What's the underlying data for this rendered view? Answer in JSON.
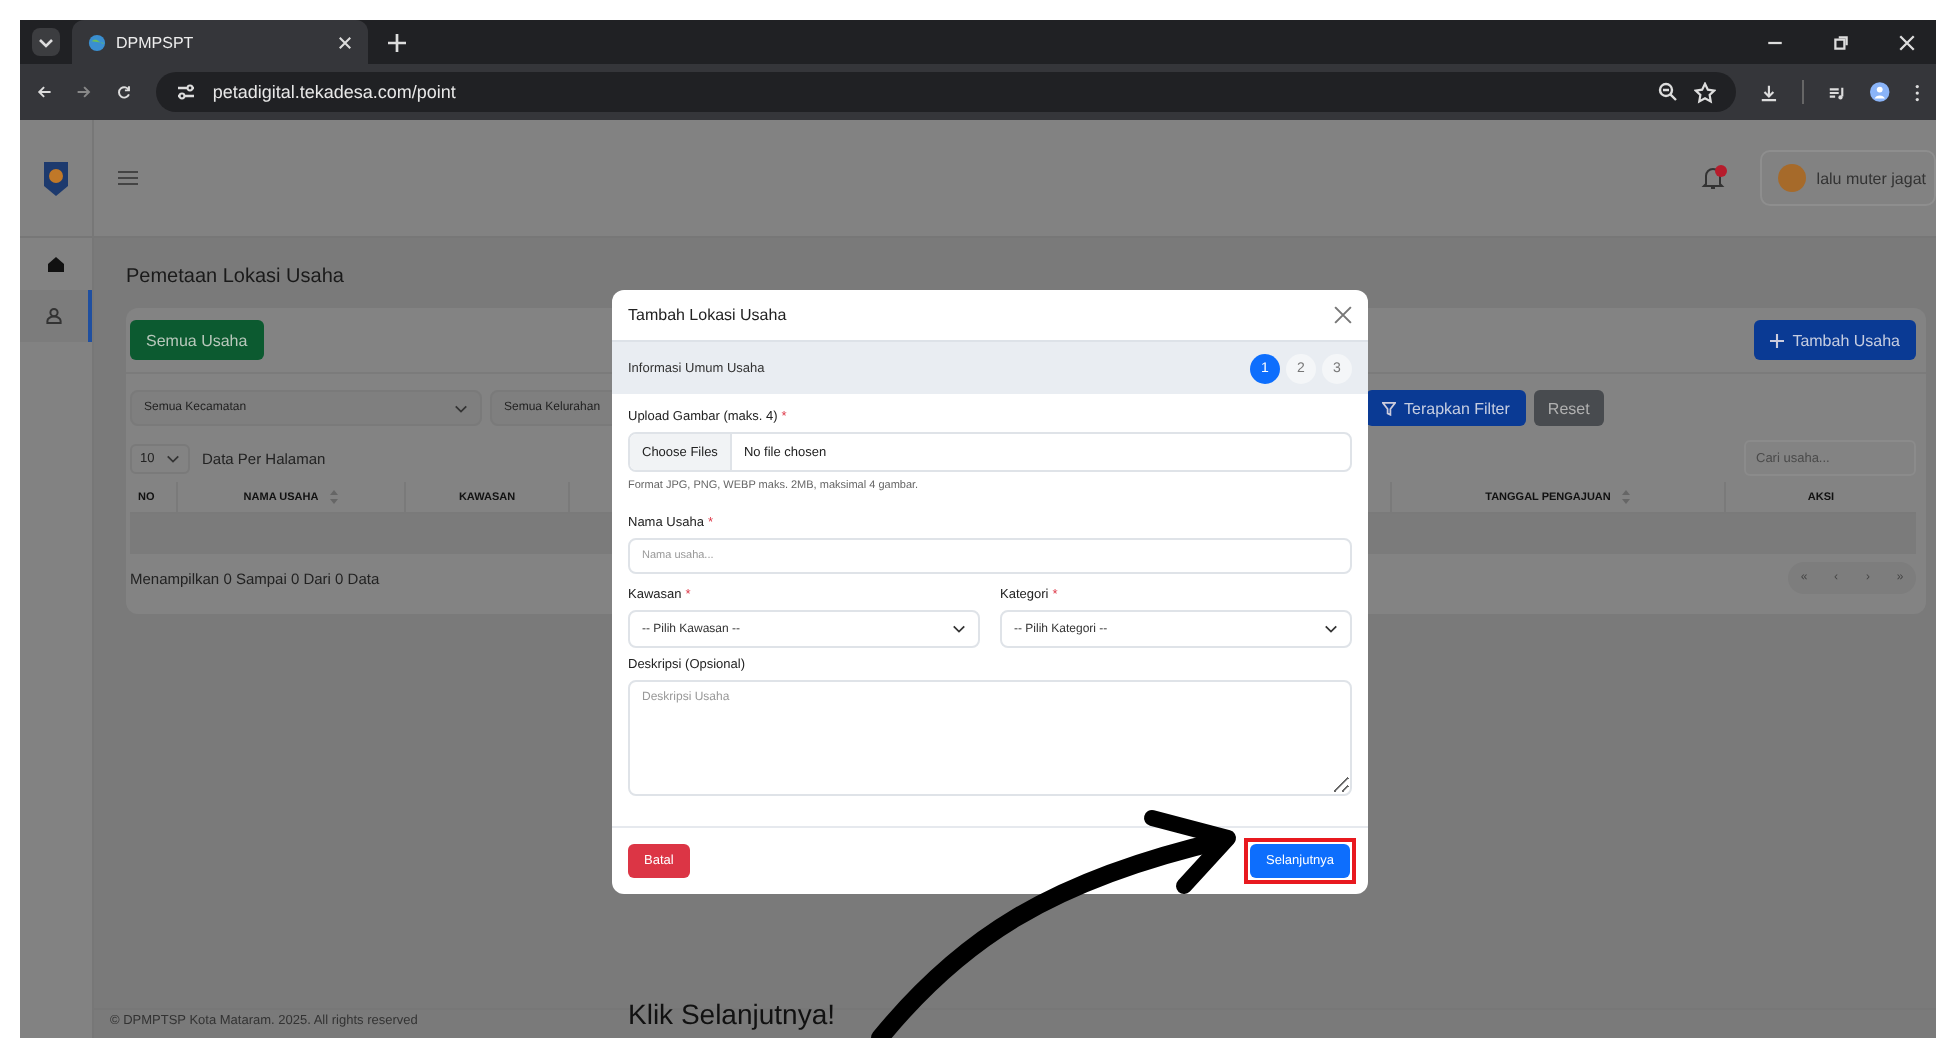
{
  "browser": {
    "tab_title": "DPMPSPT",
    "url": "petadigital.tekadesa.com/point"
  },
  "header": {
    "user_name": "lalu muter jagat"
  },
  "sidebar": {
    "items": [
      {
        "kind": "home",
        "selected": false
      },
      {
        "kind": "user",
        "selected": true
      }
    ]
  },
  "page": {
    "title": "Pemetaan Lokasi Usaha",
    "tab_button": "Semua Usaha",
    "add_button": "Tambah Usaha",
    "filters": [
      "Semua Kecamatan",
      "Semua Kelurahan"
    ],
    "apply_button": "Terapkan Filter",
    "reset_button": "Reset",
    "page_size": "10",
    "page_size_label": "Data Per Halaman",
    "search": {
      "placeholder": "Cari usaha..."
    },
    "table": {
      "columns_left": [
        {
          "label": "NO",
          "sortable": false
        },
        {
          "label": "NAMA USAHA",
          "sortable": true
        },
        {
          "label": "KAWASAN",
          "sortable": false
        }
      ],
      "columns_right": [
        {
          "label": "TANGGAL PENGAJUAN",
          "sortable": true
        },
        {
          "label": "AKSI",
          "sortable": false
        }
      ]
    },
    "summary": "Menampilkan 0 Sampai 0 Dari 0 Data",
    "pagination": [
      "«",
      "‹",
      "›",
      "»"
    ]
  },
  "footer": "© DPMPTSP Kota Mataram. 2025. All rights reserved",
  "modal": {
    "title": "Tambah Lokasi Usaha",
    "section": "Informasi Umum Usaha",
    "steps": [
      {
        "label": "1",
        "selected": true
      },
      {
        "label": "2",
        "selected": false
      },
      {
        "label": "3",
        "selected": false
      }
    ],
    "upload": {
      "label": "Upload Gambar (maks. 4)",
      "required_mark": "*",
      "button": "Choose Files",
      "value": "No file chosen",
      "hint": "Format JPG, PNG, WEBP maks. 2MB, maksimal 4 gambar."
    },
    "name": {
      "label": "Nama Usaha",
      "required_mark": "*",
      "placeholder": "Nama usaha..."
    },
    "kawasan": {
      "label": "Kawasan",
      "required_mark": "*",
      "value": "-- Pilih Kawasan --"
    },
    "kategori": {
      "label": "Kategori",
      "required_mark": "*",
      "value": "-- Pilih Kategori --"
    },
    "description": {
      "label": "Deskripsi (Opsional)",
      "placeholder": "Deskripsi Usaha"
    },
    "cancel_button": "Batal",
    "next_button": {
      "label": "Selanjutnya",
      "highlighted": true
    }
  },
  "annotation": {
    "text": "Klik Selanjutnya!"
  }
}
